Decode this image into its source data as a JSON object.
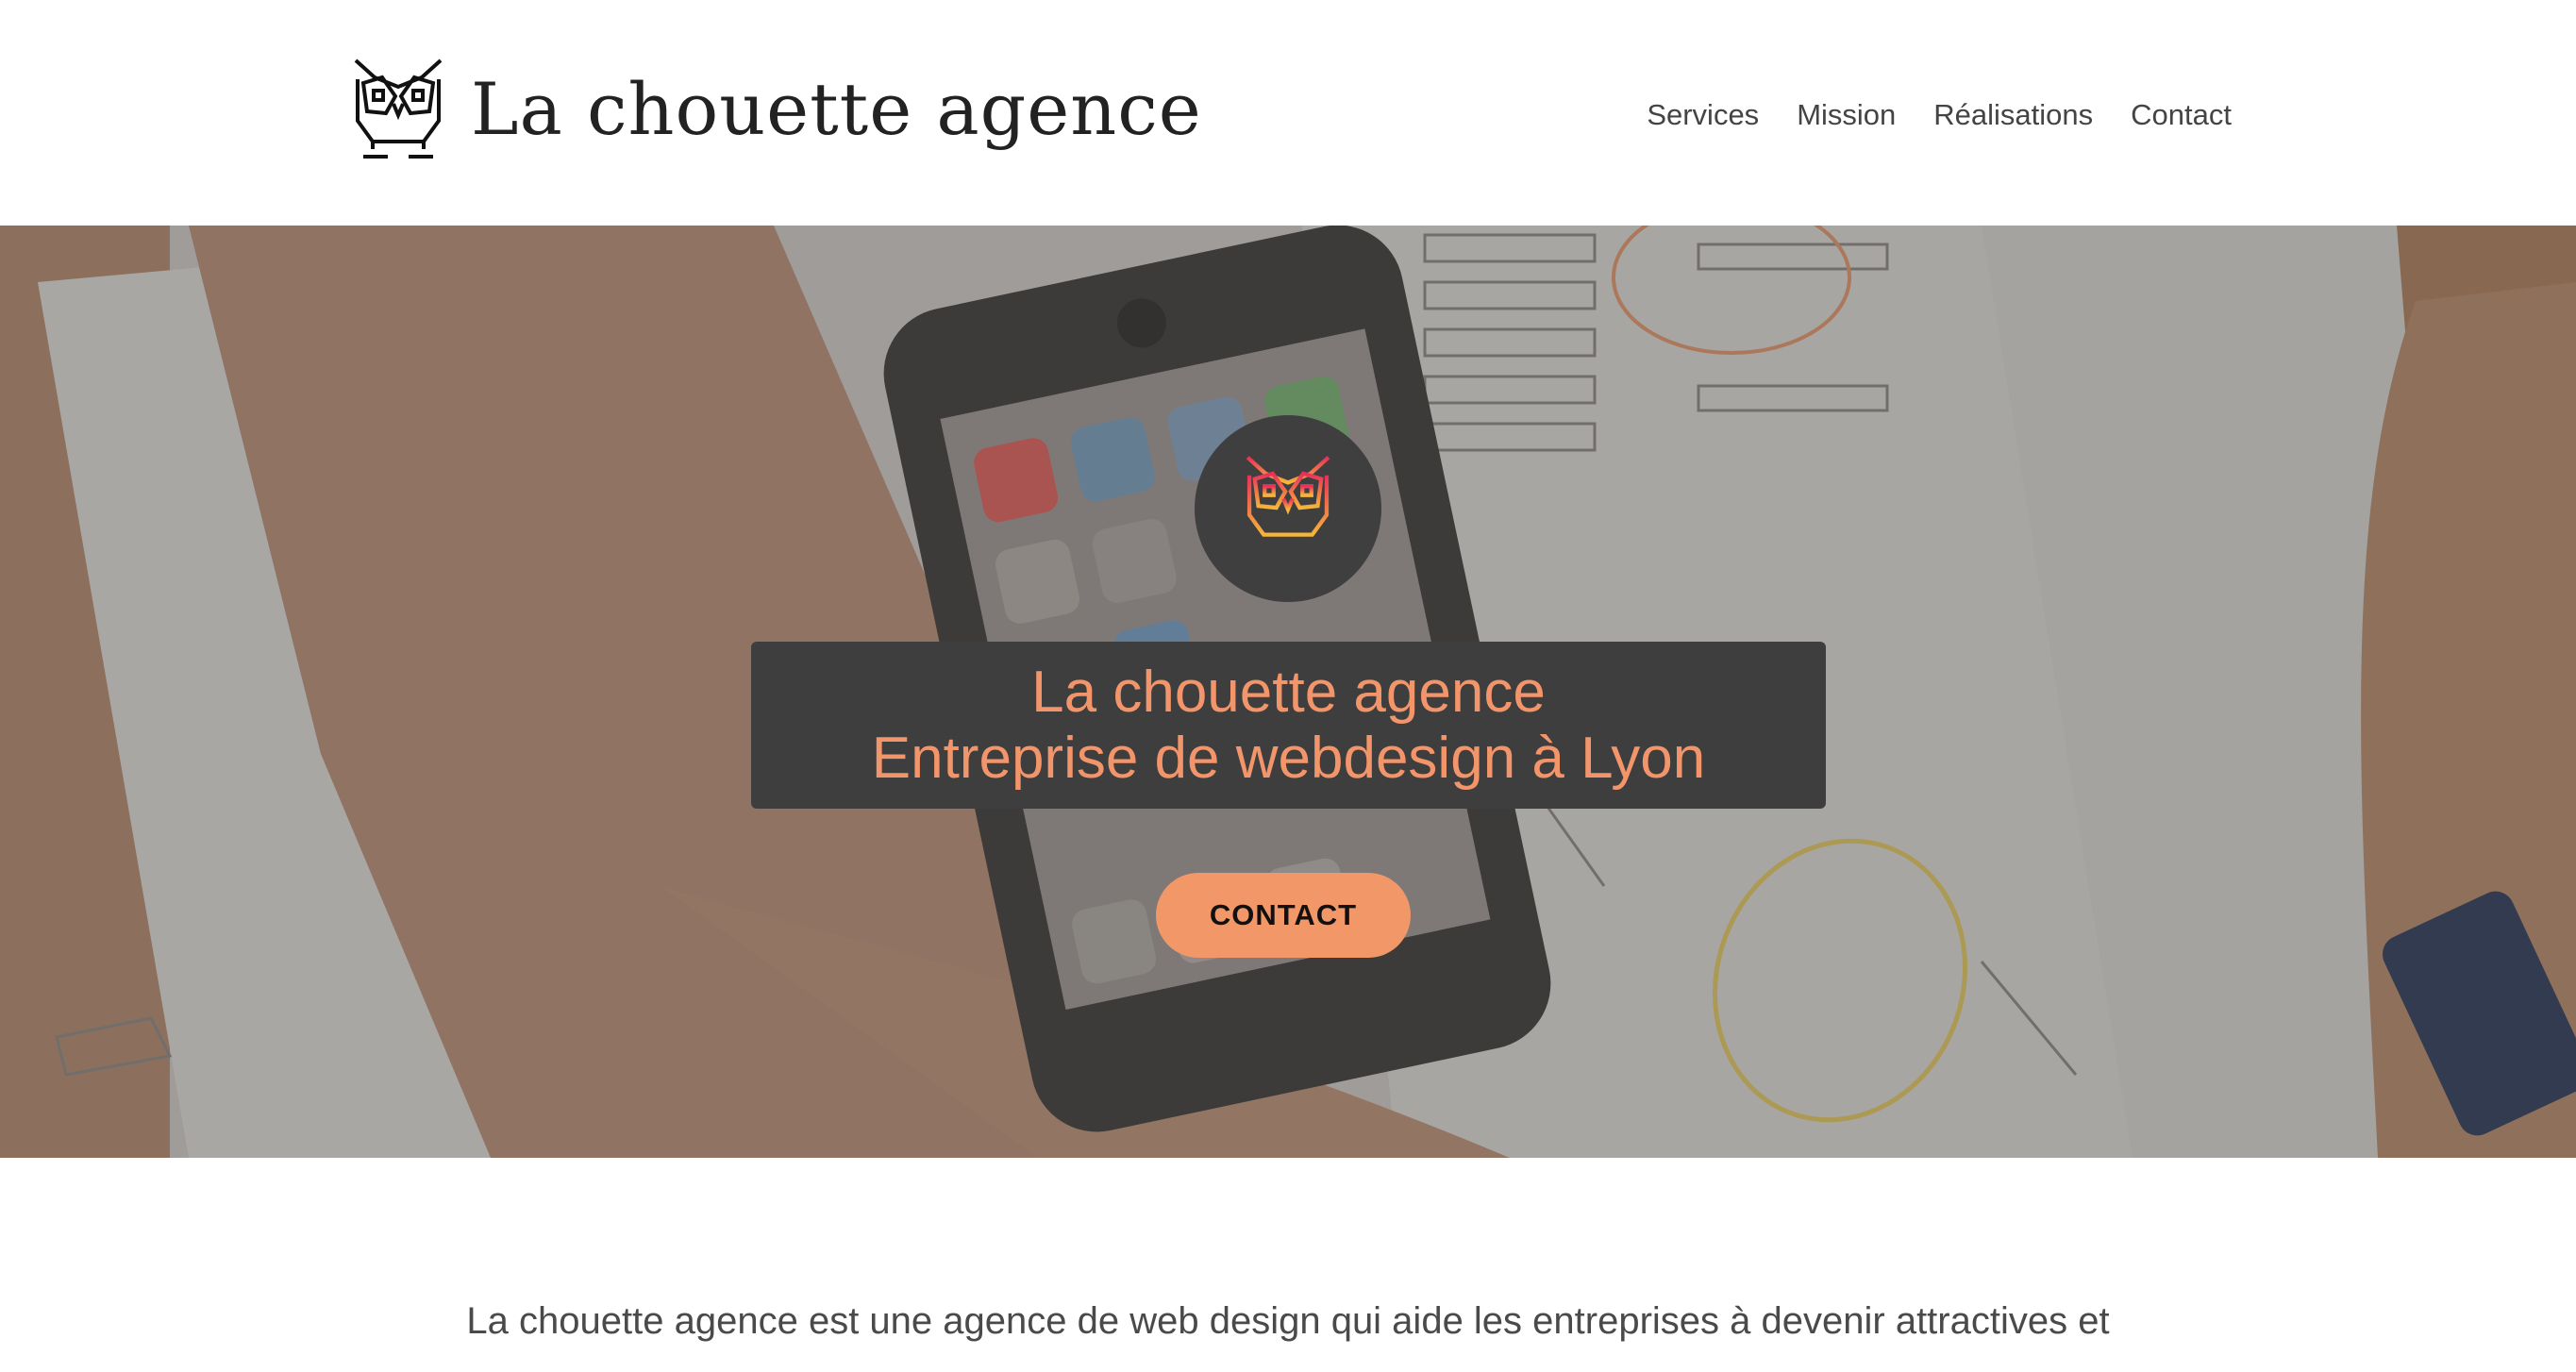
{
  "brand": {
    "name": "La chouette agence",
    "logo_icon": "owl-icon"
  },
  "nav": {
    "items": [
      "Services",
      "Mission",
      "Réalisations",
      "Contact"
    ]
  },
  "hero": {
    "badge_icon": "owl-icon",
    "title_line1": "La chouette agence",
    "title_line2": "Entreprise de webdesign à Lyon",
    "cta_label": "CONTACT",
    "accent_color": "#f29868",
    "box_color": "#3e3e3e"
  },
  "intro": {
    "text_line1": "La chouette agence est une agence de web design qui aide les entreprises à devenir attractives et"
  }
}
